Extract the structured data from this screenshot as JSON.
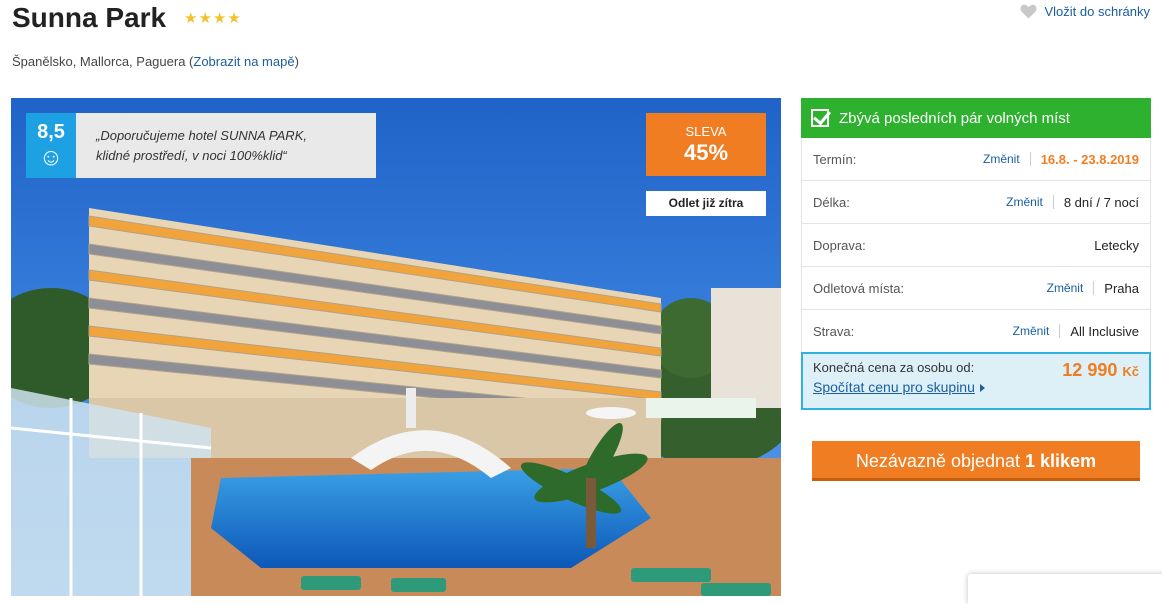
{
  "hotel": {
    "name": "Sunna Park",
    "stars": "★★★★",
    "location": "Španělsko, Mallorca, Paguera",
    "map_link": "Zobrazit na mapě"
  },
  "favorite": {
    "label": "Vložit do schránky",
    "icon": "heart-icon"
  },
  "rating": {
    "score": "8,5",
    "face": "☺",
    "quote_line1": "„Doporučujeme hotel SUNNA PARK,",
    "quote_line2": "klidné prostředí, v noci 100%klid“"
  },
  "discount": {
    "label": "SLEVA",
    "value": "45%"
  },
  "departure_badge": "Odlet již zítra",
  "availability": "Zbývá posledních pár volných míst",
  "details": [
    {
      "label": "Termín:",
      "change": "Změnit",
      "value": "16.8. - 23.8.2019"
    },
    {
      "label": "Délka:",
      "change": "Změnit",
      "value": "8 dní / 7 nocí"
    },
    {
      "label": "Doprava:",
      "value": "Letecky"
    },
    {
      "label": "Odletová místa:",
      "change": "Změnit",
      "value": "Praha"
    },
    {
      "label": "Strava:",
      "change": "Změnit",
      "value": "All Inclusive"
    }
  ],
  "price": {
    "label": "Konečná cena za osobu od:",
    "amount": "12 990",
    "currency": "Kč",
    "group_link": "Spočítat cenu pro skupinu"
  },
  "order_button": {
    "text": "Nezávazně objednat ",
    "bold": "1 klikem"
  },
  "colors": {
    "accent": "#f07d22",
    "link": "#1a5ea0",
    "availability": "#2eb12e",
    "rating": "#1da1e2"
  }
}
